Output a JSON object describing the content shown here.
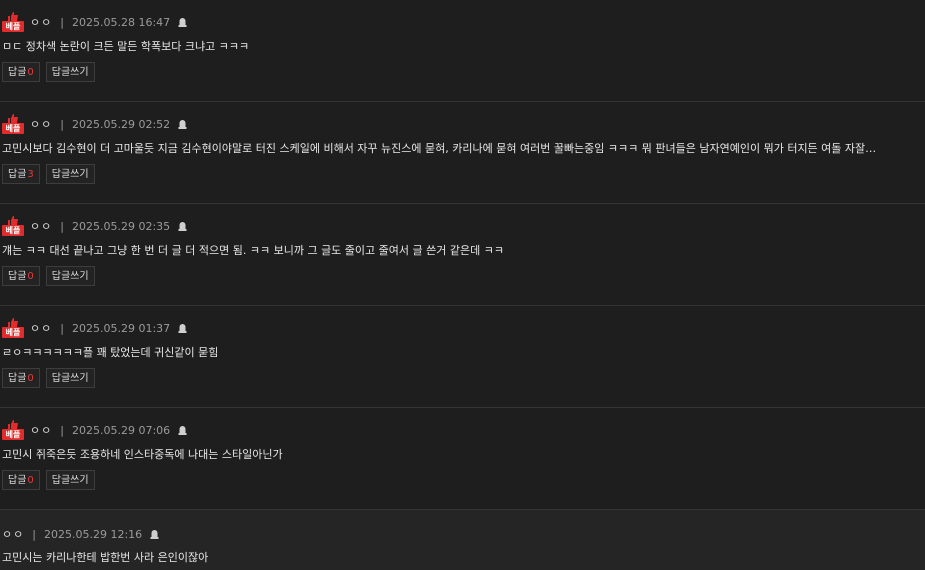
{
  "badge_label": "베플",
  "comments": [
    {
      "nick": "ㅇㅇ",
      "date": "2025.05.28 16:47",
      "text": "ㅁㄷ 정차색 논란이 크든 말든 학폭보다 크냐고 ㅋㅋㅋ",
      "reply_label": "답글",
      "reply_count": "0",
      "write_label": "답글쓰기"
    },
    {
      "nick": "ㅇㅇ",
      "date": "2025.05.29 02:52",
      "text": "고민시보다 김수현이 더 고마울듯 지금 김수현이야말로 터진 스케일에 비해서 자꾸 뉴진스에 묻혀, 카리나에 묻혀 여러번 꿀빠는중임 ㅋㅋㅋ 뭐 판녀들은 남자연예인이 뭐가 터지든 여돌 자잘한 논란이 더 중요하시니까...",
      "reply_label": "답글",
      "reply_count": "3",
      "write_label": "답글쓰기"
    },
    {
      "nick": "ㅇㅇ",
      "date": "2025.05.29 02:35",
      "text": "걔는 ㅋㅋ 대선 끝나고 그냥 한 번 더 글 더 적으면 됨. ㅋㅋ 보니까 그 글도 줄이고 줄여서 글 쓴거 같은데 ㅋㅋ",
      "reply_label": "답글",
      "reply_count": "0",
      "write_label": "답글쓰기"
    },
    {
      "nick": "ㅇㅇ",
      "date": "2025.05.29 01:37",
      "text": "ㄹㅇㅋㅋㅋㅋㅋㅋ플 꽤 탔었는데 귀신같이 묻힘",
      "reply_label": "답글",
      "reply_count": "0",
      "write_label": "답글쓰기"
    },
    {
      "nick": "ㅇㅇ",
      "date": "2025.05.29 07:06",
      "text": "고민시 쥐죽은듯 조용하네 인스타중독에 나대는 스타일아닌가",
      "reply_label": "답글",
      "reply_count": "0",
      "write_label": "답글쓰기"
    }
  ],
  "reply": {
    "nick": "ㅇㅇ",
    "date": "2025.05.29 12:16",
    "text": "고민시는 카리나한테 밥한번 사라 은인이잖아"
  }
}
